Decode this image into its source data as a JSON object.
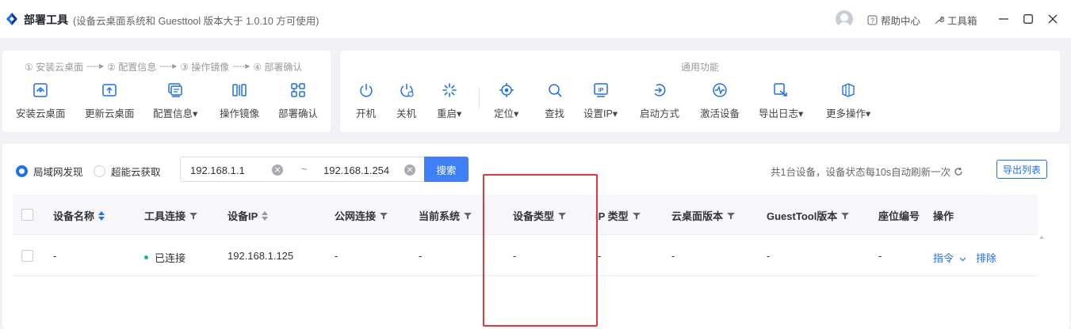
{
  "app": {
    "title": "部署工具",
    "subtitle": "(设备云桌面系统和 Guesttool 版本大于 1.0.10 方可使用)",
    "help_label": "帮助中心",
    "tools_label": "工具箱"
  },
  "deploy_steps": {
    "step1": "① 安装云桌面",
    "step2": "② 配置信息",
    "step3": "③ 操作镜像",
    "step4": "④ 部署确认",
    "arrow": "----▸",
    "tools": [
      {
        "label": "安装云桌面",
        "icon": "install-desktop-icon"
      },
      {
        "label": "更新云桌面",
        "icon": "update-desktop-icon"
      },
      {
        "label": "配置信息▾",
        "icon": "config-info-icon"
      },
      {
        "label": "操作镜像",
        "icon": "image-operation-icon"
      },
      {
        "label": "部署确认",
        "icon": "deploy-confirm-icon"
      }
    ]
  },
  "common": {
    "heading": "通用功能",
    "tools": [
      {
        "label": "开机",
        "icon": "power-on-icon"
      },
      {
        "label": "关机",
        "icon": "power-off-icon"
      },
      {
        "label": "重启▾",
        "icon": "restart-icon"
      },
      {
        "label": "定位▾",
        "icon": "locate-icon"
      },
      {
        "label": "查找",
        "icon": "search-icon"
      },
      {
        "label": "设置IP▾",
        "icon": "set-ip-icon"
      },
      {
        "label": "启动方式",
        "icon": "boot-mode-icon"
      },
      {
        "label": "激活设备",
        "icon": "activate-device-icon"
      },
      {
        "label": "导出日志▾",
        "icon": "export-log-icon"
      },
      {
        "label": "更多操作▾",
        "icon": "more-actions-icon"
      }
    ]
  },
  "discovery": {
    "lan_label": "局域网发现",
    "cloud_label": "超能云获取",
    "selected": "局域网发现",
    "ip_start": "192.168.1.1",
    "ip_end": "192.168.1.254",
    "range_sep": "~",
    "search_label": "搜索",
    "status": "共1台设备，设备状态每10s自动刷新一次",
    "export_label": "导出列表"
  },
  "table": {
    "headers": {
      "name": "设备名称",
      "tool_conn": "工具连接",
      "ip": "设备IP",
      "public": "公网连接",
      "os": "当前系统",
      "type": "设备类型",
      "ip_type": "IP 类型",
      "desktop_ver": "云桌面版本",
      "guesttool_ver": "GuestTool版本",
      "seat": "座位编号",
      "action": "操作"
    },
    "rows": [
      {
        "name": "-",
        "tool_conn": "已连接",
        "ip": "192.168.1.125",
        "public": "-",
        "os": "-",
        "type": "-",
        "ip_type": "-",
        "desktop_ver": "-",
        "guesttool_ver": "-",
        "seat": "-",
        "cmd": "指令",
        "remove": "排除"
      }
    ]
  },
  "colors": {
    "accent": "#1e6ff1",
    "search_button": "#4080f6",
    "connected": "#1bb86d",
    "highlight": "#e8353b"
  }
}
